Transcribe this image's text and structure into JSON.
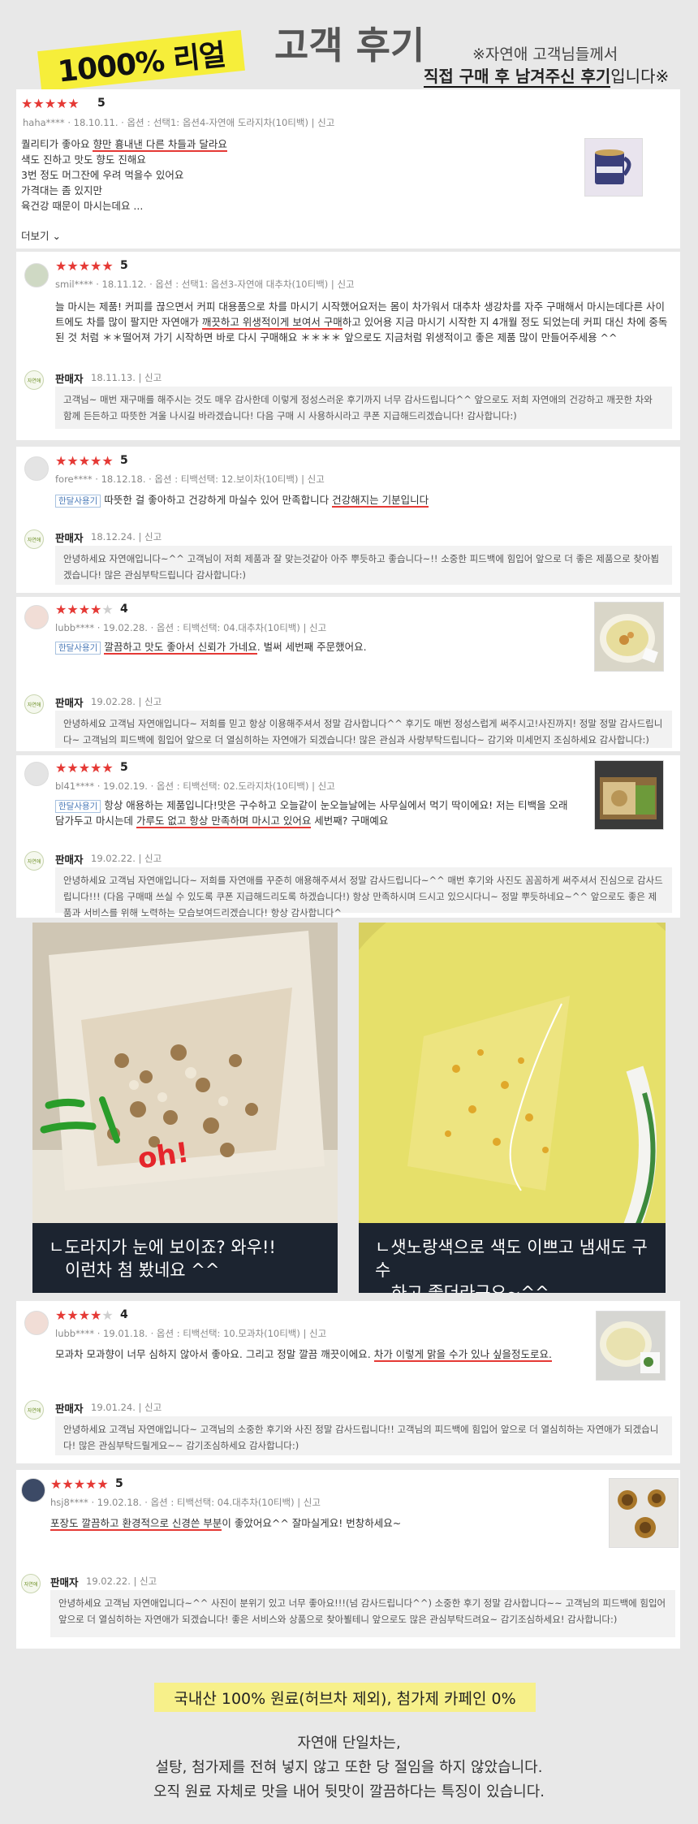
{
  "header": {
    "badge": "1000% 리얼",
    "title": "고객 후기",
    "note_line1": "※자연애 고객님들께서",
    "note_line2_bold": "직접 구매 후 남겨주신 후기",
    "note_line2_rest": "입니다※"
  },
  "labels": {
    "seller": "판매자",
    "more": "더보기",
    "report": "신고",
    "tag": "한달사용기"
  },
  "reviews": [
    {
      "stars": 5,
      "rating": "5",
      "meta": "haha**** · 18.10.11. · 옵션 : 선택1: 옵션4-자연애 도라지차(10티백)  |  신고",
      "lines": [
        "퀄리티가 좋아요 ",
        "향만 흉내낸 다른 차들과 달라요",
        "색도 진하고 맛도 향도 진해요",
        "3번 정도 머그잔에 우려 먹을수 있어요",
        "가격대는 좀 있지만",
        "육건강 때문이 마시는데요 ..."
      ]
    },
    {
      "stars": 5,
      "rating": "5",
      "meta": "smil**** · 18.11.12.  · 옵션 : 선택1: 옵션3-자연애 대추차(10티백)  |  신고",
      "text_a": "늘 마시는 제품! 커피를 끊으면서 커피 대용품으로 차를 마시기 시작했어요저는 몸이 차가워서 대추차 생강차를 자주 구매해서 마시는데다른 사이트에도 차를 많이 팔지만 자연애가 ",
      "text_hl": "깨끗하고 위생적이게 보여서 구매",
      "text_b": "하고 있어용 지금 마시기 시작한 지 4개월 정도 되었는데 커피 대신 차에 중독된 것 처럼 ＊＊떨어져 가기 시작하면 바로 다시 구매해요 ＊＊＊＊  앞으로도 지금처럼 위생적이고 좋은 제품 많이 만들어주세용 ^^",
      "seller_date": "18.11.13.  |  신고",
      "reply": "고객님~ 매번 재구매를 해주시는 것도 매우 감사한데 이렇게 정성스러운 후기까지 너무 감사드립니다^^ 앞으로도 저희 자연애의 건강하고 깨끗한 차와 함께 든든하고 따뜻한 겨울 나시길 바라겠습니다! 다음 구매 시 사용하시라고 쿠폰 지급해드리겠습니다! 감사합니다:)"
    },
    {
      "stars": 5,
      "rating": "5",
      "meta": "fore**** · 18.12.18.  · 옵션 : 티백선택: 12.보이차(10티백)  |  신고",
      "text_a": "따뜻한 걸 좋아하고 건강하게 마실수 있어 만족합니다 ",
      "text_hl": "건강해지는 기분입니다",
      "seller_date": "18.12.24.  |  신고",
      "reply": "안녕하세요 자연애입니다~^^ 고객님이 저희 제품과 잘 맞는것같아 아주 뿌듯하고 좋습니다~!! 소중한 피드백에 힘입어 앞으로 더 좋은 제품으로 찾아뵙겠습니다! 많은 관심부탁드립니다 감사합니다:)"
    },
    {
      "stars": 4,
      "rating": "4",
      "meta": "lubb**** · 19.02.28.  · 옵션 : 티백선택: 04.대추차(10티백)  |  신고",
      "text_hl": "깔끔하고 맛도 좋아서 신뢰가 가네요",
      "text_b": ". 벌써 세번째 주문했어요.",
      "seller_date": "19.02.28.  |  신고",
      "reply": "안녕하세요 고객님 자연애입니다~ 저희를 믿고 항상 이용해주셔서 정말 감사합니다^^ 후기도 매번 정성스럽게 써주시고!사진까지! 정말 정말 감사드립니다~ 고객님의 피드백에 힘입어 앞으로 더 열심히하는 자연애가 되겠습니다! 많은 관심과 사랑부탁드립니다~ 감기와 미세먼지 조심하세요 감사합니다:)"
    },
    {
      "stars": 5,
      "rating": "5",
      "meta": "bl41**** · 19.02.19.  · 옵션 : 티백선택: 02.도라지차(10티백)  |  신고",
      "text_a": "항상 애용하는 제품입니다!맛은 구수하고 오늘같이 눈오늘날에는 사무실에서 먹기 딱이에요! 저는 티백을 오래 담가두고 마시는데 ",
      "text_hl": "가루도 없고 항상 만족하며 마시고 있어요",
      "text_b": " 세번째? 구매예요",
      "seller_date": "19.02.22.  |  신고",
      "reply": "안녕하세요 고객님 자연애입니다~ 저희를 자연애를 꾸준히 애용해주셔서 정말 감사드립니다~^^ 매번 후기와 사진도 꼼꼼하게 써주셔서 진심으로 감사드립니다!!! (다음 구매때 쓰실 수 있도록 쿠폰 지급해드리도록 하겠습니다!) 항상 만족하시며 드시고 있으시다니~ 정말 뿌듯하네요~^^ 앞으로도 좋은 제품과 서비스를 위해 노력하는 모습보여드리겠습니다! 항상 감사합니다^"
    },
    {
      "stars": 4,
      "rating": "4",
      "meta": "lubb**** · 19.01.18.  · 옵션 : 티백선택: 10.모과차(10티백)  |  신고",
      "text_a": "모과차 모과향이 너무 심하지 않아서 좋아요. 그리고 정말 깔끔 깨끗이에요. ",
      "text_hl": "차가 이렇게 맑을 수가 있나 싶을정도로요.",
      "seller_date": "19.01.24.  |  신고",
      "reply": "안녕하세요 고객님 자연애입니다~ 고객님의 소중한 후기와 사진 정말 감사드립니다!! 고객님의 피드백에 힘입어 앞으로 더 열심히하는 자연애가 되겠습니다! 많은 관심부탁드릴게요~~ 감기조심하세요 감사합니다:)"
    },
    {
      "stars": 5,
      "rating": "5",
      "meta": "hsj8**** · 19.02.18.  · 옵션 : 티백선택: 04.대추차(10티백)  |  신고",
      "text_hl": "포장도 깔끔하고 환경적으로 신경쓴 부분",
      "text_b": "이 좋았어요^^ 잘마실게요! 번창하세요~",
      "seller_date": "19.02.22.  |  신고",
      "reply": "안녕하세요 고객님 자연애입니다~^^ 사진이 분위기 있고 너무 좋아요!!!(넘 감사드립니다^^) 소중한 후기 정말 감사합니다~~ 고객님의 피드백에 힘입어 앞으로 더 열심히하는 자연애가 되겠습니다! 좋은 서비스와 상품으로 찾아뵐테니 앞으로도 많은 관심부탁드려요~ 감기조심하세요! 감사합니다:)"
    }
  ],
  "photos": {
    "left_scribble": "oh!",
    "left_cap1": "ㄴ도라지가 눈에 보이죠? 와우!!",
    "left_cap2": "이런차 첨 봤네요 ^^",
    "right_cap1": "ㄴ샛노랑색으로 색도 이쁘고 냄새도 구수",
    "right_cap2": "하고 좋더라구요~^^"
  },
  "footer": {
    "highlight": "국내산 100% 원료(허브차 제외), 첨가제 카페인 0%",
    "line1": "자연애 단일차는,",
    "line2": "설탕, 첨가제를 전혀 넣지 않고 또한 당 절임을 하지 않았습니다.",
    "line3": "오직 원료 자체로 맛을 내어 뒷맛이 깔끔하다는 특징이 있습니다."
  },
  "colors": {
    "star": "#e53935",
    "underline": "#e53935",
    "badge": "#f6ee3a",
    "footer_highlight": "#f7f08a",
    "caption_bg": "#1c2430"
  }
}
